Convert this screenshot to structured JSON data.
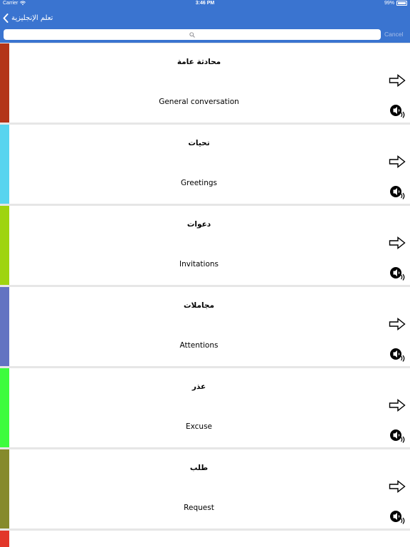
{
  "status": {
    "carrier": "Carrier",
    "time": "3:46 PM",
    "battery": "99%"
  },
  "nav": {
    "back_label": "تعلم الإنجليزية"
  },
  "search": {
    "placeholder": "",
    "cancel_label": "Cancel"
  },
  "colors": {
    "nav_bg": "#3a74d0",
    "list_bg": "#e6e6e6"
  },
  "icons": {
    "row_action": "arrow-right-icon",
    "row_audio": "speaker-icon"
  },
  "categories": [
    {
      "arabic": "محادثة عامة",
      "english": "General conversation",
      "color": "#b33418"
    },
    {
      "arabic": "تحيات",
      "english": "Greetings",
      "color": "#58d4ef"
    },
    {
      "arabic": "دعوات",
      "english": "Invitations",
      "color": "#9fd40f"
    },
    {
      "arabic": "مجاملات",
      "english": "Attentions",
      "color": "#6373c2"
    },
    {
      "arabic": "عذر",
      "english": "Excuse",
      "color": "#3dfc3d"
    },
    {
      "arabic": "طلب",
      "english": "Request",
      "color": "#868a2c"
    },
    {
      "arabic": "",
      "english": "",
      "color": "#e2372a"
    }
  ]
}
